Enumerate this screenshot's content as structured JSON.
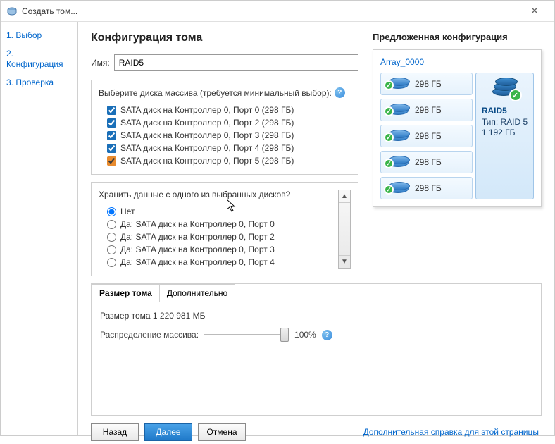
{
  "window": {
    "title": "Создать том..."
  },
  "sidebar": {
    "steps": [
      {
        "label": "1. Выбор"
      },
      {
        "label": "2. Конфигурация"
      },
      {
        "label": "3. Проверка"
      }
    ]
  },
  "header": {
    "title": "Конфигурация тома"
  },
  "name_field": {
    "label": "Имя:",
    "value": "RAID5"
  },
  "disk_select": {
    "header": "Выберите диска массива (требуется минимальный выбор):",
    "disks": [
      {
        "label": "SATA диск на Контроллер 0, Порт 0 (298 ГБ)",
        "checked": true
      },
      {
        "label": "SATA диск на Контроллер 0, Порт 2 (298 ГБ)",
        "checked": true
      },
      {
        "label": "SATA диск на Контроллер 0, Порт 3 (298 ГБ)",
        "checked": true
      },
      {
        "label": "SATA диск на Контроллер 0, Порт 4 (298 ГБ)",
        "checked": true
      },
      {
        "label": "SATA диск на Контроллер 0, Порт 5 (298 ГБ)",
        "checked": true
      }
    ]
  },
  "preserve": {
    "header": "Хранить данные с одного из выбранных дисков?",
    "options": [
      {
        "label": "Нет",
        "selected": true
      },
      {
        "label": "Да: SATA диск на Контроллер 0, Порт 0",
        "selected": false
      },
      {
        "label": "Да: SATA диск на Контроллер 0, Порт 2",
        "selected": false
      },
      {
        "label": "Да: SATA диск на Контроллер 0, Порт 3",
        "selected": false
      },
      {
        "label": "Да: SATA диск на Контроллер 0, Порт 4",
        "selected": false
      }
    ]
  },
  "tabs": {
    "items": [
      {
        "label": "Размер тома",
        "active": true
      },
      {
        "label": "Дополнительно",
        "active": false
      }
    ],
    "size": {
      "label": "Размер тома",
      "value": "1 220 981 МБ"
    },
    "allocation": {
      "label": "Распределение массива:",
      "value": "100%"
    }
  },
  "proposed": {
    "title": "Предложенная конфигурация",
    "array_name": "Array_0000",
    "disks": [
      {
        "size": "298 ГБ"
      },
      {
        "size": "298 ГБ"
      },
      {
        "size": "298 ГБ"
      },
      {
        "size": "298 ГБ"
      },
      {
        "size": "298 ГБ"
      }
    ],
    "raid": {
      "name": "RAID5",
      "type": "Тип: RAID 5",
      "capacity": "1 192 ГБ"
    }
  },
  "footer": {
    "back": "Назад",
    "next": "Далее",
    "cancel": "Отмена",
    "help": "Дополнительная справка для этой страницы"
  }
}
